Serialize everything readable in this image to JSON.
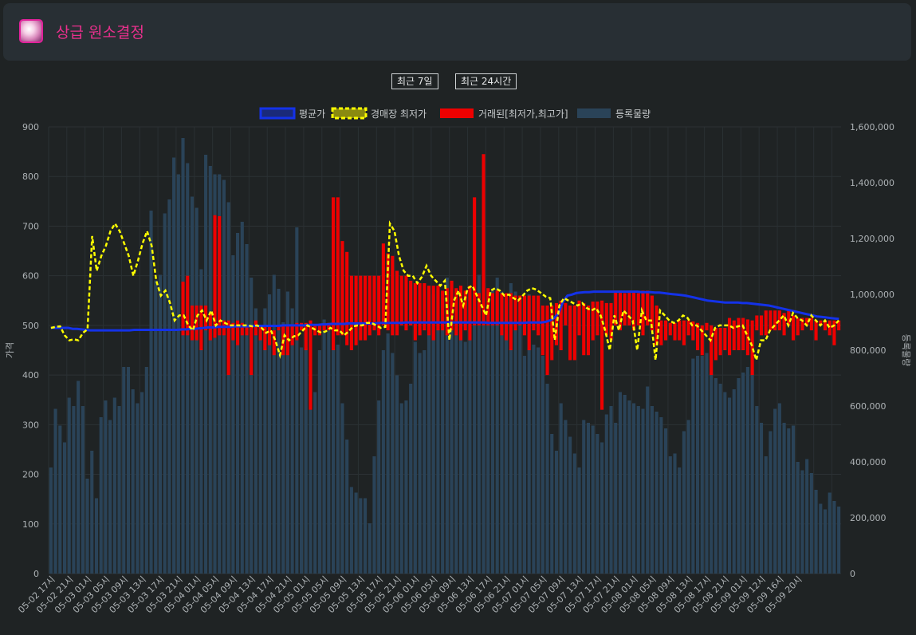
{
  "header": {
    "title": "상급 원소결정",
    "icon": "pink-crystal-item-icon",
    "title_color": "#e8308c"
  },
  "controls": {
    "range_7d": "최근 7일",
    "range_24h": "최근 24시간"
  },
  "chart_data": {
    "type": "bar",
    "legend": [
      {
        "label": "평균가",
        "color": "#1432e8",
        "kind": "line"
      },
      {
        "label": "경매장 최저가",
        "color": "#ffff00",
        "kind": "dashed-line"
      },
      {
        "label": "거래된[최저가,최고가]",
        "color": "#ee0000",
        "kind": "floating-bar"
      },
      {
        "label": "등록물량",
        "color": "#2a4358",
        "kind": "bar"
      }
    ],
    "legend_position": "top",
    "y_left": {
      "label": "가격",
      "min": 0,
      "max": 900,
      "ticks": [
        0,
        100,
        200,
        300,
        400,
        500,
        600,
        700,
        800,
        900
      ]
    },
    "y_right": {
      "label": "등록물량",
      "min": 0,
      "max": 1600000,
      "ticks": [
        "0",
        "200,000",
        "400,000",
        "600,000",
        "800,000",
        "1,000,000",
        "1,200,000",
        "1,400,000",
        "1,600,000"
      ]
    },
    "grid": true,
    "x_tick_labels": [
      "05-02 17시",
      "05-02 21시",
      "05-03 01시",
      "05-03 05시",
      "05-03 09시",
      "05-03 13시",
      "05-03 17시",
      "05-03 21시",
      "05-04 01시",
      "05-04 05시",
      "05-04 09시",
      "05-04 13시",
      "05-04 17시",
      "05-04 21시",
      "05-05 01시",
      "05-05 05시",
      "05-05 09시",
      "05-05 13시",
      "05-05 17시",
      "05-05 21시",
      "05-06 01시",
      "05-06 05시",
      "05-06 09시",
      "05-06 13시",
      "05-06 17시",
      "05-06 21시",
      "05-07 01시",
      "05-07 05시",
      "05-07 09시",
      "05-07 13시",
      "05-07 17시",
      "05-07 21시",
      "05-08 01시",
      "05-08 05시",
      "05-08 09시",
      "05-08 13시",
      "05-08 17시",
      "05-08 21시",
      "05-09 01시",
      "05-09 12시",
      "05-09 16시",
      "05-09 20시"
    ],
    "tick_every": 4,
    "series": [
      {
        "name": "등록물량",
        "axis": "right",
        "values": [
          380000,
          590000,
          530000,
          470000,
          630000,
          600000,
          690000,
          600000,
          340000,
          440000,
          270000,
          560000,
          620000,
          550000,
          630000,
          600000,
          740000,
          740000,
          660000,
          610000,
          650000,
          740000,
          1300000,
          1050000,
          1070000,
          1290000,
          1340000,
          1490000,
          1430000,
          1560000,
          1470000,
          1350000,
          1310000,
          1090000,
          1500000,
          1460000,
          1430000,
          1430000,
          1410000,
          1330000,
          1140000,
          1220000,
          1260000,
          1180000,
          1060000,
          950000,
          850000,
          950000,
          1000000,
          1070000,
          1020000,
          900000,
          1010000,
          950000,
          1240000,
          810000,
          810000,
          710000,
          650000,
          800000,
          910000,
          890000,
          850000,
          820000,
          610000,
          480000,
          310000,
          290000,
          270000,
          270000,
          180000,
          420000,
          620000,
          800000,
          860000,
          790000,
          710000,
          610000,
          620000,
          680000,
          830000,
          790000,
          800000,
          900000,
          1000000,
          1020000,
          1000000,
          1060000,
          1000000,
          990000,
          920000,
          830000,
          1000000,
          1000000,
          1070000,
          1040000,
          960000,
          1020000,
          1060000,
          1010000,
          980000,
          1040000,
          1010000,
          890000,
          780000,
          1000000,
          820000,
          810000,
          780000,
          680000,
          500000,
          440000,
          610000,
          550000,
          490000,
          430000,
          380000,
          550000,
          540000,
          530000,
          500000,
          470000,
          570000,
          600000,
          540000,
          650000,
          640000,
          620000,
          610000,
          600000,
          590000,
          670000,
          600000,
          580000,
          560000,
          520000,
          420000,
          430000,
          380000,
          510000,
          550000,
          770000,
          780000,
          780000,
          790000,
          720000,
          700000,
          680000,
          650000,
          630000,
          660000,
          700000,
          720000,
          740000,
          730000,
          600000,
          540000,
          420000,
          510000,
          590000,
          610000,
          540000,
          520000,
          530000,
          400000,
          370000,
          410000,
          360000,
          300000,
          250000,
          230000,
          290000,
          260000,
          240000
        ]
      },
      {
        "name": "평균가",
        "axis": "left",
        "values": [
          495,
          495,
          495,
          495,
          495,
          493,
          493,
          492,
          491,
          490,
          490,
          490,
          490,
          490,
          490,
          490,
          490,
          490,
          490,
          491,
          491,
          491,
          491,
          491,
          491,
          491,
          491,
          491,
          491,
          491,
          492,
          492,
          493,
          493,
          494,
          495,
          496,
          496,
          497,
          497,
          497,
          497,
          498,
          498,
          498,
          498,
          499,
          499,
          499,
          499,
          499,
          499,
          499,
          500,
          500,
          500,
          500,
          500,
          500,
          501,
          501,
          501,
          502,
          502,
          503,
          503,
          503,
          503,
          504,
          504,
          504,
          504,
          504,
          504,
          504,
          505,
          505,
          505,
          505,
          505,
          505,
          506,
          506,
          506,
          506,
          506,
          506,
          506,
          506,
          506,
          506,
          506,
          506,
          506,
          506,
          506,
          506,
          506,
          506,
          506,
          505,
          505,
          505,
          505,
          505,
          505,
          505,
          505,
          505,
          506,
          506,
          506,
          506,
          507,
          510,
          515,
          525,
          548,
          560,
          562,
          565,
          566,
          567,
          567,
          568,
          568,
          568,
          568,
          568,
          568,
          568,
          568,
          568,
          568,
          568,
          567,
          567,
          567,
          566,
          566,
          565,
          564,
          563,
          562,
          561,
          560,
          558,
          556,
          554,
          552,
          550,
          549,
          548,
          547,
          546,
          546,
          546,
          546,
          545,
          545,
          544,
          543,
          542,
          541,
          540,
          538,
          536,
          534,
          532,
          530,
          528,
          526,
          524,
          522,
          520,
          518,
          517,
          516,
          515,
          514,
          513
        ]
      },
      {
        "name": "경매장 최저가",
        "axis": "left",
        "values": [
          495,
          497,
          498,
          480,
          470,
          472,
          470,
          485,
          492,
          680,
          610,
          640,
          660,
          690,
          705,
          690,
          665,
          640,
          600,
          630,
          665,
          690,
          660,
          590,
          560,
          570,
          545,
          510,
          520,
          520,
          500,
          490,
          520,
          530,
          510,
          530,
          500,
          510,
          505,
          500,
          500,
          500,
          500,
          500,
          498,
          500,
          495,
          485,
          490,
          470,
          440,
          480,
          470,
          478,
          480,
          490,
          500,
          495,
          490,
          485,
          488,
          495,
          490,
          490,
          480,
          488,
          498,
          500,
          500,
          505,
          505,
          500,
          495,
          497,
          705,
          690,
          640,
          610,
          600,
          600,
          585,
          598,
          620,
          600,
          590,
          580,
          590,
          470,
          550,
          570,
          540,
          575,
          580,
          560,
          540,
          520,
          570,
          575,
          570,
          560,
          562,
          555,
          550,
          560,
          570,
          575,
          572,
          565,
          558,
          555,
          470,
          540,
          555,
          550,
          545,
          540,
          545,
          535,
          530,
          535,
          520,
          490,
          450,
          520,
          490,
          530,
          520,
          510,
          450,
          530,
          510,
          510,
          430,
          530,
          520,
          510,
          505,
          510,
          520,
          515,
          500,
          500,
          490,
          480,
          470,
          495,
          500,
          500,
          500,
          495,
          498,
          500,
          480,
          460,
          430,
          470,
          470,
          490,
          500,
          510,
          520,
          500,
          525,
          515,
          510,
          500,
          520,
          510,
          500,
          510,
          495,
          500,
          510
        ]
      },
      {
        "name": "거래된[최저가,최고가]",
        "axis": "left",
        "type": "floating",
        "ranges": [
          [
            480,
            588
          ],
          [
            480,
            600
          ],
          [
            470,
            540
          ],
          [
            470,
            540
          ],
          [
            450,
            540
          ],
          [
            490,
            540
          ],
          [
            470,
            525
          ],
          [
            475,
            722
          ],
          [
            480,
            720
          ],
          [
            480,
            510
          ],
          [
            400,
            510
          ],
          [
            470,
            505
          ],
          [
            460,
            510
          ],
          [
            480,
            505
          ],
          [
            480,
            500
          ],
          [
            400,
            500
          ],
          [
            480,
            510
          ],
          [
            470,
            500
          ],
          [
            450,
            500
          ],
          [
            460,
            500
          ],
          [
            440,
            490
          ],
          [
            490,
            500
          ],
          [
            440,
            500
          ],
          [
            440,
            500
          ],
          [
            460,
            500
          ],
          [
            470,
            505
          ],
          [
            490,
            505
          ],
          [
            450,
            505
          ],
          [
            330,
            510
          ],
          [
            480,
            500
          ],
          [
            480,
            500
          ],
          [
            490,
            500
          ],
          [
            490,
            505
          ],
          [
            450,
            758
          ],
          [
            480,
            758
          ],
          [
            480,
            670
          ],
          [
            460,
            648
          ],
          [
            450,
            600
          ],
          [
            460,
            600
          ],
          [
            470,
            600
          ],
          [
            470,
            600
          ],
          [
            480,
            600
          ],
          [
            490,
            600
          ],
          [
            480,
            600
          ],
          [
            500,
            665
          ],
          [
            490,
            645
          ],
          [
            480,
            640
          ],
          [
            480,
            610
          ],
          [
            500,
            600
          ],
          [
            490,
            600
          ],
          [
            500,
            590
          ],
          [
            470,
            585
          ],
          [
            480,
            585
          ],
          [
            490,
            585
          ],
          [
            480,
            580
          ],
          [
            470,
            580
          ],
          [
            490,
            580
          ],
          [
            490,
            570
          ],
          [
            480,
            575
          ],
          [
            490,
            590
          ],
          [
            480,
            575
          ],
          [
            470,
            580
          ],
          [
            490,
            570
          ],
          [
            470,
            580
          ],
          [
            500,
            758
          ],
          [
            500,
            565
          ],
          [
            500,
            845
          ],
          [
            500,
            575
          ],
          [
            500,
            565
          ],
          [
            500,
            570
          ],
          [
            480,
            565
          ],
          [
            470,
            565
          ],
          [
            450,
            565
          ],
          [
            490,
            560
          ],
          [
            500,
            560
          ],
          [
            480,
            560
          ],
          [
            450,
            560
          ],
          [
            490,
            560
          ],
          [
            480,
            560
          ],
          [
            440,
            540
          ],
          [
            400,
            540
          ],
          [
            430,
            540
          ],
          [
            460,
            545
          ],
          [
            450,
            550
          ],
          [
            500,
            545
          ],
          [
            430,
            540
          ],
          [
            430,
            540
          ],
          [
            480,
            550
          ],
          [
            440,
            545
          ],
          [
            440,
            540
          ],
          [
            470,
            548
          ],
          [
            480,
            548
          ],
          [
            330,
            550
          ],
          [
            480,
            545
          ],
          [
            470,
            545
          ],
          [
            500,
            570
          ],
          [
            490,
            570
          ],
          [
            500,
            565
          ],
          [
            500,
            570
          ],
          [
            490,
            568
          ],
          [
            500,
            565
          ],
          [
            480,
            570
          ],
          [
            500,
            570
          ],
          [
            490,
            560
          ],
          [
            460,
            540
          ],
          [
            460,
            510
          ],
          [
            470,
            510
          ],
          [
            480,
            505
          ],
          [
            470,
            505
          ],
          [
            470,
            510
          ],
          [
            460,
            510
          ],
          [
            480,
            510
          ],
          [
            470,
            508
          ],
          [
            450,
            505
          ],
          [
            440,
            500
          ],
          [
            490,
            505
          ],
          [
            400,
            500
          ],
          [
            430,
            495
          ],
          [
            440,
            495
          ],
          [
            450,
            495
          ],
          [
            440,
            515
          ],
          [
            450,
            510
          ],
          [
            450,
            515
          ],
          [
            450,
            515
          ],
          [
            440,
            512
          ],
          [
            400,
            510
          ],
          [
            490,
            520
          ],
          [
            480,
            520
          ],
          [
            480,
            530
          ],
          [
            490,
            530
          ],
          [
            490,
            530
          ],
          [
            490,
            530
          ],
          [
            480,
            525
          ],
          [
            500,
            530
          ],
          [
            470,
            520
          ],
          [
            480,
            515
          ],
          [
            490,
            515
          ],
          [
            500,
            515
          ],
          [
            490,
            515
          ],
          [
            470,
            510
          ],
          [
            500,
            510
          ],
          [
            490,
            510
          ],
          [
            480,
            510
          ],
          [
            460,
            510
          ],
          [
            490,
            510
          ]
        ]
      }
    ]
  }
}
